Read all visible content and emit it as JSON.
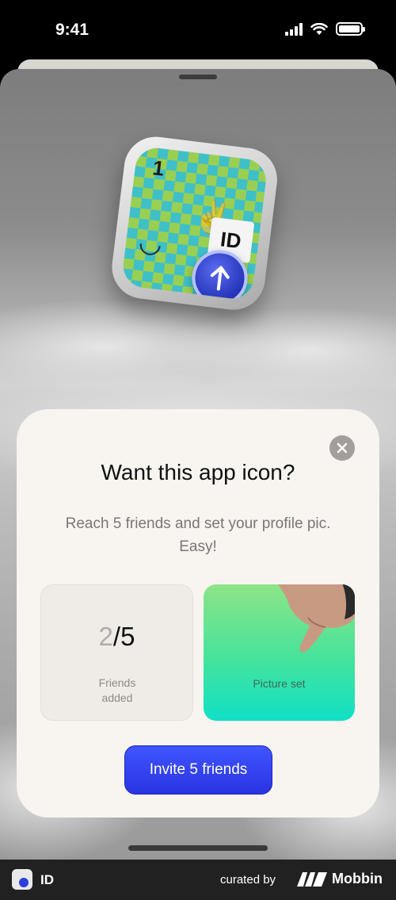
{
  "status_bar": {
    "time": "9:41"
  },
  "modal": {
    "title": "Want this app icon?",
    "description": "Reach 5 friends and set your profile pic. Easy!",
    "friends_tile": {
      "done": "2",
      "total": "/5",
      "label": "Friends added"
    },
    "picture_tile": {
      "label": "Picture set"
    },
    "invite_label": "Invite 5 friends"
  },
  "app_icon": {
    "number": "1",
    "id_text": "ID"
  },
  "footer": {
    "app_name": "ID",
    "curated_by": "curated by",
    "brand": "Mobbin"
  },
  "colors": {
    "accent": "#2f3ef0",
    "sheet": "#f8f4f0",
    "tile_green": "#45e39c"
  }
}
